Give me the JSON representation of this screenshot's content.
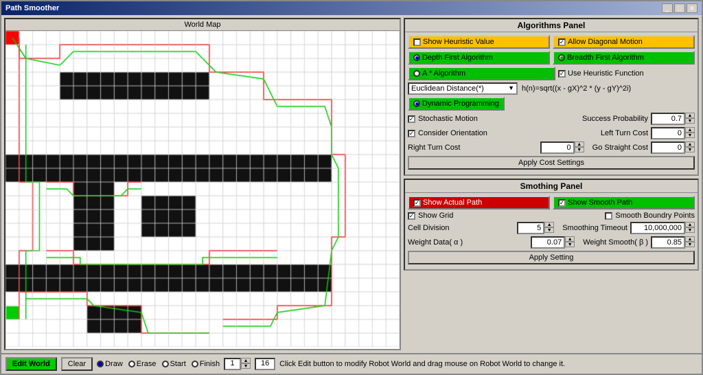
{
  "window": {
    "title": "Path Smoother",
    "left_panel_title": "World Map",
    "right_panel_algo_title": "Algorithms Panel",
    "right_panel_smooth_title": "Smothing Panel"
  },
  "algo_panel": {
    "show_heuristic_label": "Show Heuristic Value",
    "allow_diagonal_label": "Allow Diagonal Motion",
    "depth_first_label": "Depth First Algorithm",
    "breadth_first_label": "Breadth First Algorithm",
    "a_star_label": "A * Algorithm",
    "use_heuristic_label": "Use Heuristic Function",
    "dropdown_label": "Euclidean Distance(*)",
    "formula": "h(n)=sqrt((x - gX)^2 * (y - gY)^2i)",
    "dynamic_programming_label": "Dynamic Programming",
    "stochastic_motion_label": "Stochastic Motion",
    "success_probability_label": "Success Probability",
    "success_probability_value": "0.7",
    "consider_orientation_label": "Consider Orientation",
    "left_turn_cost_label": "Left Turn Cost",
    "left_turn_cost_value": "0",
    "right_turn_cost_label": "Right Turn Cost",
    "right_turn_cost_value": "0",
    "go_straight_label": "Go Straight Cost",
    "go_straight_value": "0",
    "apply_cost_label": "Apply Cost Settings"
  },
  "smooth_panel": {
    "show_actual_path_label": "Show Actual Path",
    "show_smooth_path_label": "Show Smooth Path",
    "show_grid_label": "Show Grid",
    "smooth_boundary_label": "Smooth Boundry Points",
    "cell_division_label": "Cell Division",
    "cell_division_value": "5",
    "smoothing_timeout_label": "Smoothing Timeout",
    "smoothing_timeout_value": "10,000,000",
    "weight_data_label": "Weight Data( α )",
    "weight_data_value": "0.07",
    "weight_smooth_label": "Weight Smooth( β )",
    "weight_smooth_value": "0.85",
    "apply_setting_label": "Apply Setting"
  },
  "bottom_bar": {
    "edit_world_label": "Edit World",
    "clear_label": "Clear",
    "draw_label": "Draw",
    "erase_label": "Erase",
    "start_label": "Start",
    "finish_label": "Finish",
    "counter_value": "1",
    "counter_max": "16",
    "status_text": "Click Edit button to modify Robot World and drag mouse on Robot World to change it."
  }
}
